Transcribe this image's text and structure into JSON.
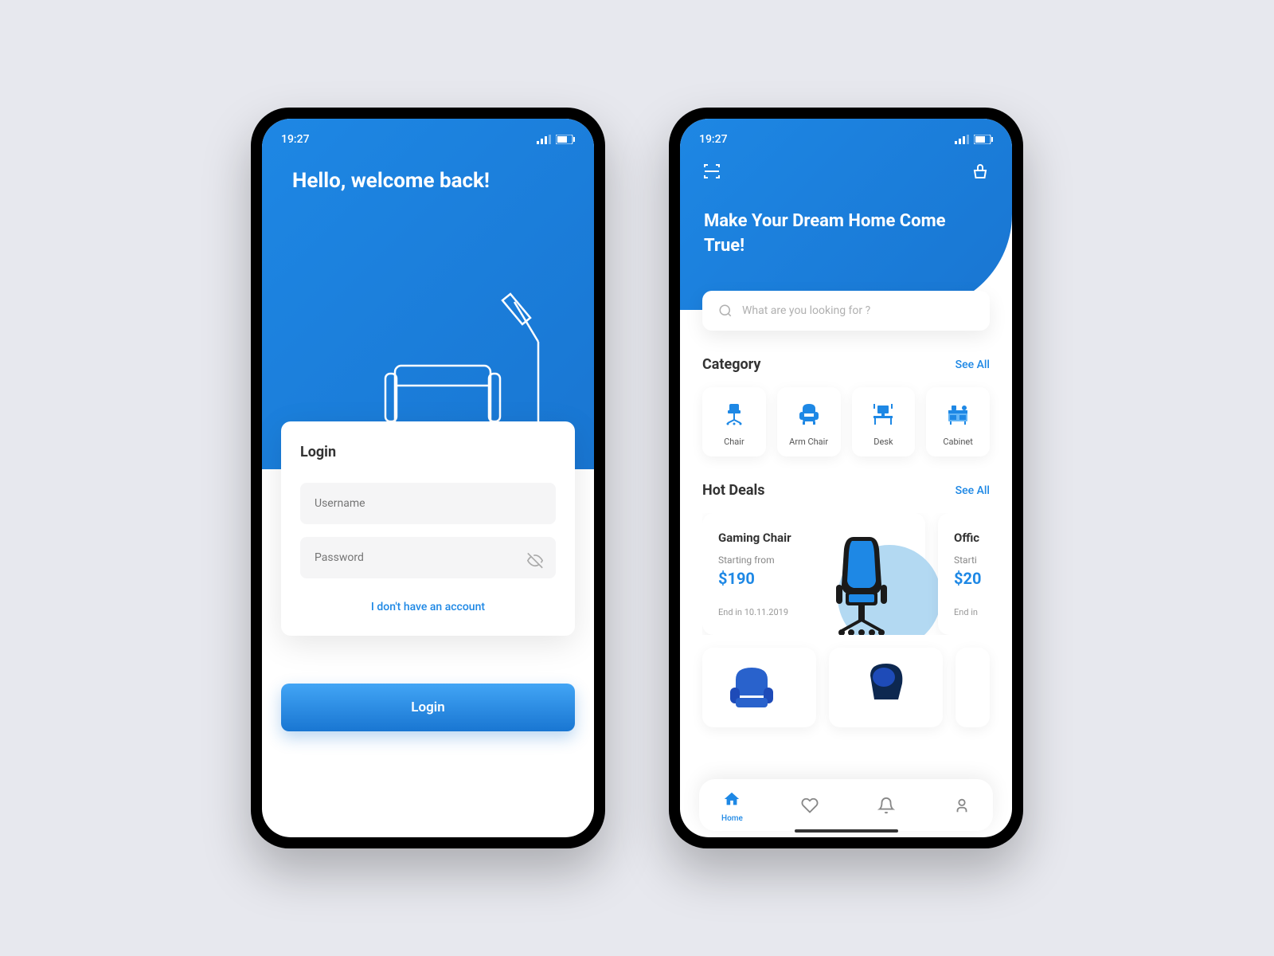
{
  "status": {
    "time": "19:27"
  },
  "login": {
    "greeting": "Hello, welcome back!",
    "card_title": "Login",
    "username_placeholder": "Username",
    "password_placeholder": "Password",
    "no_account": "I don't have an account",
    "button": "Login"
  },
  "home": {
    "title": "Make Your Dream Home Come True!",
    "search_placeholder": "What are you looking for ?",
    "category": {
      "title": "Category",
      "see_all": "See All",
      "items": [
        "Chair",
        "Arm Chair",
        "Desk",
        "Cabinet"
      ]
    },
    "deals": {
      "title": "Hot Deals",
      "see_all": "See All",
      "items": [
        {
          "name": "Gaming Chair",
          "sub": "Starting from",
          "price": "$190",
          "end": "End in 10.11.2019"
        },
        {
          "name": "Offic",
          "sub": "Starti",
          "price": "$20",
          "end": "End in"
        }
      ]
    },
    "nav": {
      "home": "Home"
    }
  }
}
